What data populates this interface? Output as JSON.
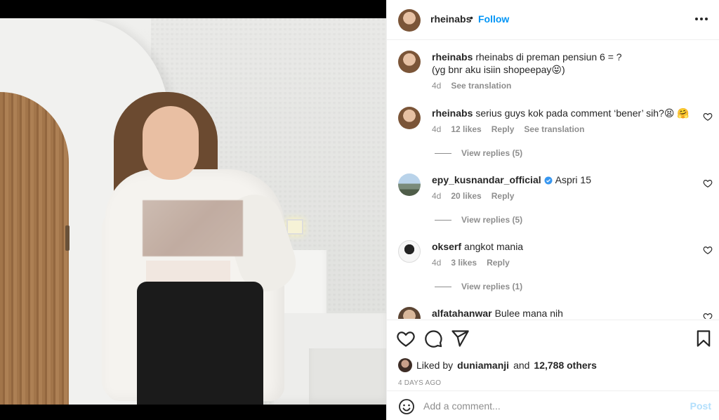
{
  "post": {
    "username": "rheinabs",
    "dot": "•",
    "follow_label": "Follow"
  },
  "comments": [
    {
      "username": "rheinabs",
      "text_line1": "rheinabs di preman pensiun 6 = ?",
      "text_line2": "(yg bnr aku isiin shopeepay😝)",
      "time": "4d",
      "see_translation": "See translation"
    },
    {
      "username": "rheinabs",
      "text": "serius guys kok pada comment ‘bener’ sih?😫 🤗",
      "time": "4d",
      "likes": "12 likes",
      "reply": "Reply",
      "see_translation": "See translation",
      "view_replies": "View replies (5)"
    },
    {
      "username": "epy_kusnandar_official",
      "text": "Aspri 15",
      "time": "4d",
      "likes": "20 likes",
      "reply": "Reply",
      "view_replies": "View replies (5)"
    },
    {
      "username": "okserf",
      "text": "angkot mania",
      "time": "4d",
      "likes": "3 likes",
      "reply": "Reply",
      "view_replies": "View replies (1)"
    },
    {
      "username": "alfatahanwar",
      "text": "Bulee mana nih"
    }
  ],
  "likes": {
    "prefix": "Liked by",
    "liker": "duniamanji",
    "and": "and",
    "others": "12,788 others"
  },
  "timestamp": "4 DAYS AGO",
  "add_comment": {
    "placeholder": "Add a comment...",
    "post_label": "Post"
  },
  "colors": {
    "follow": "#0095f6",
    "post_disabled": "#b2dffc",
    "secondary_text": "#8e8e8e",
    "verified": "#3897f0"
  },
  "icons": [
    "more-icon",
    "heart-icon",
    "comment-icon",
    "share-icon",
    "bookmark-icon",
    "emoji-icon",
    "verified-icon"
  ]
}
